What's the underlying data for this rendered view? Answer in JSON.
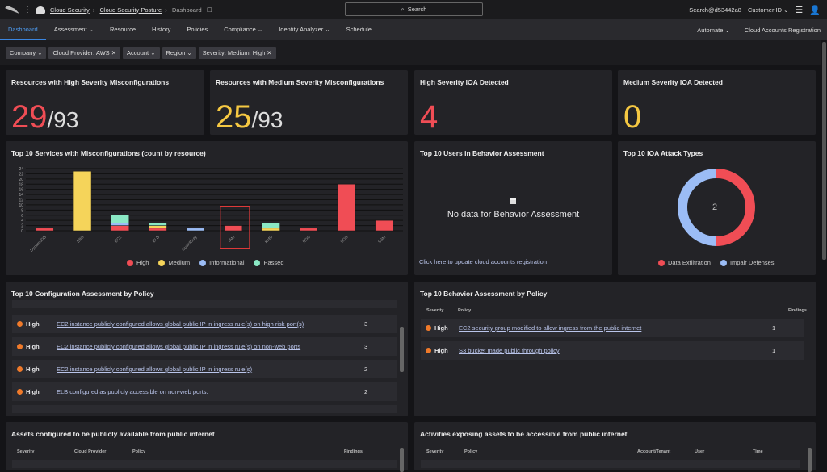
{
  "header": {
    "breadcrumb": [
      "Cloud Security",
      "Cloud Security Posture",
      "Dashboard"
    ],
    "search_placeholder": "Search",
    "user": "Search@d53442a8",
    "customer": "Customer ID"
  },
  "nav": {
    "tabs": [
      "Dashboard",
      "Assessment",
      "Resource",
      "History",
      "Policies",
      "Compliance",
      "Identity Analyzer",
      "Schedule"
    ],
    "right": [
      "Automate",
      "Cloud Accounts Registration"
    ],
    "active": "Dashboard"
  },
  "filters": [
    "Company",
    "Cloud Provider: AWS",
    "Account",
    "Region",
    "Severity: Medium, High"
  ],
  "kpis": [
    {
      "title": "Resources with High Severity Misconfigurations",
      "value": "29",
      "total": "/93",
      "color": "#f04d55"
    },
    {
      "title": "Resources with Medium Severity Misconfigurations",
      "value": "25",
      "total": "/93",
      "color": "#f5c842"
    },
    {
      "title": "High Severity IOA Detected",
      "value": "4",
      "total": "",
      "color": "#f04d55"
    },
    {
      "title": "Medium Severity IOA Detected",
      "value": "0",
      "total": "",
      "color": "#f5c842"
    }
  ],
  "services_chart": {
    "title": "Top 10 Services with Misconfigurations (count by resource)"
  },
  "chart_data": [
    {
      "type": "bar",
      "stacked": true,
      "categories": [
        "DynamoDB",
        "EBS",
        "EC2",
        "ELB",
        "GuardDuty",
        "IAM",
        "KMS",
        "RDS",
        "SQS",
        "SSM"
      ],
      "series": [
        {
          "name": "High",
          "color": "#f04d55",
          "values": [
            1,
            0,
            2,
            1,
            0,
            2,
            0,
            1,
            18,
            4
          ]
        },
        {
          "name": "Medium",
          "color": "#f5d45a",
          "values": [
            0,
            23,
            0,
            1,
            0,
            0,
            1,
            0,
            0,
            0
          ]
        },
        {
          "name": "Informational",
          "color": "#9bbcf5",
          "values": [
            0,
            0,
            1,
            0,
            1,
            0,
            0,
            0,
            0,
            0
          ]
        },
        {
          "name": "Passed",
          "color": "#8ae8c4",
          "values": [
            0,
            0,
            3,
            1,
            0,
            0,
            2,
            0,
            0,
            0
          ]
        }
      ],
      "yticks": [
        0,
        2,
        4,
        6,
        8,
        10,
        12,
        14,
        16,
        18,
        20,
        22,
        24
      ],
      "ylim": [
        0,
        24
      ],
      "grid": true,
      "legend": "bottom",
      "highlighted": "IAM"
    },
    {
      "type": "pie",
      "donut": true,
      "title": "Top 10 IOA Attack Types",
      "center_label": "2",
      "categories": [
        "Data Exfiltration",
        "Impair Defenses"
      ],
      "values": [
        1,
        1
      ],
      "colors": [
        "#f04d55",
        "#9bbcf5"
      ],
      "legend": "bottom"
    }
  ],
  "users": {
    "title": "Top 10 Users in Behavior Assessment",
    "empty": "No data for Behavior Assessment",
    "link": "Click here to update cloud accounts registration"
  },
  "config_policy": {
    "title": "Top 10 Configuration Assessment by Policy",
    "rows": [
      {
        "severity": "High",
        "policy": "EC2 instance publicly configured allows global public IP in ingress rule(s) on high risk port(s)",
        "findings": "3"
      },
      {
        "severity": "High",
        "policy": "EC2 instance publicly configured allows global public IP in ingress rule(s) on non-web ports",
        "findings": "3"
      },
      {
        "severity": "High",
        "policy": "EC2 instance publicly configured allows global public IP in ingress rule(s)",
        "findings": "2"
      },
      {
        "severity": "High",
        "policy": "ELB configured as publicly accessible on non-web ports.",
        "findings": "2"
      }
    ]
  },
  "behavior_policy": {
    "title": "Top 10 Behavior Assessment by Policy",
    "headers": [
      "Severity",
      "Policy",
      "Findings"
    ],
    "rows": [
      {
        "severity": "High",
        "policy": "EC2 security group modified to allow ingress from the public internet",
        "findings": "1"
      },
      {
        "severity": "High",
        "policy": "S3 bucket made public through policy",
        "findings": "1"
      }
    ]
  },
  "assets": {
    "title": "Assets configured to be publicly available from public internet",
    "headers": [
      "Severity",
      "Cloud Provider",
      "Policy",
      "Findings"
    ]
  },
  "activities": {
    "title": "Activities exposing assets to be accessible from public internet",
    "headers": [
      "Severity",
      "Policy",
      "Account/Tenant",
      "User",
      "Time"
    ]
  }
}
